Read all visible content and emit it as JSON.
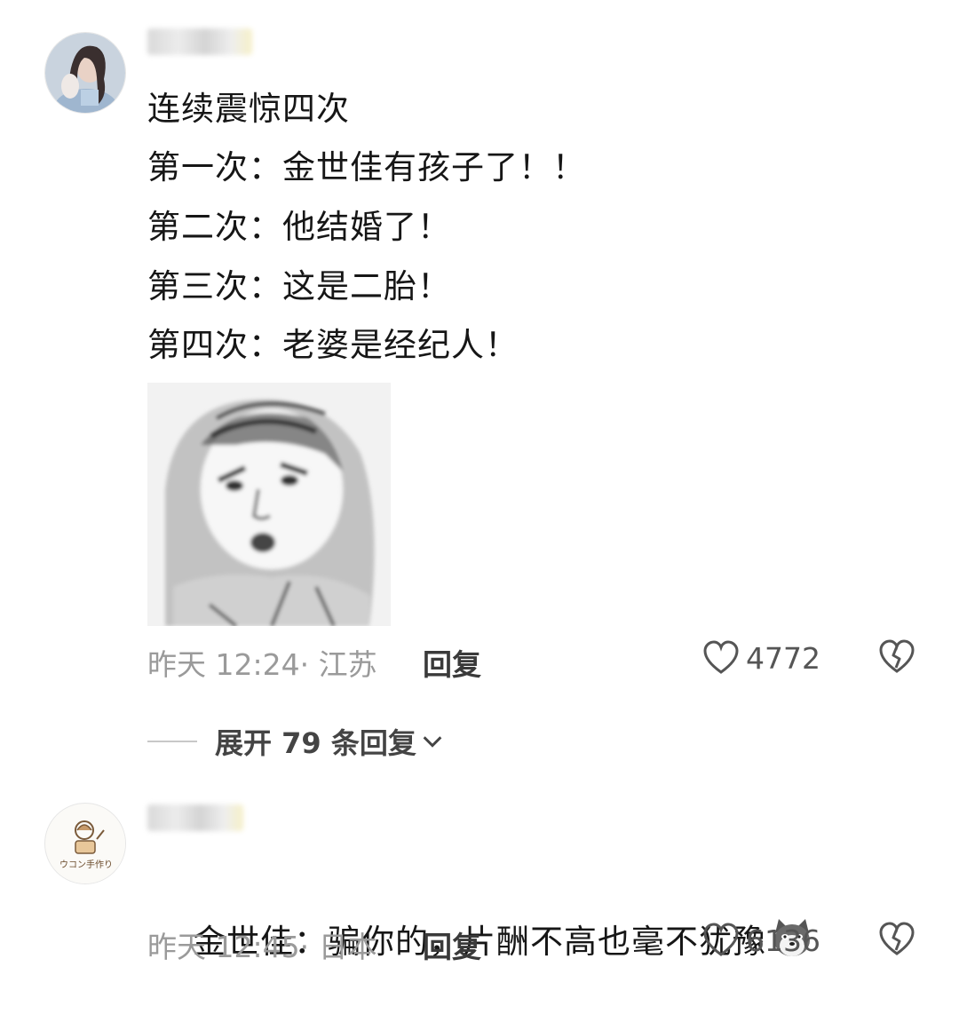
{
  "comments": [
    {
      "lines": [
        "连续震惊四次",
        "第一次：金世佳有孩子了！！",
        "第二次：他结婚了！",
        "第三次：这是二胎！",
        "第四次：老婆是经纪人！"
      ],
      "time": "昨天 12:24· 江苏",
      "reply_label": "回复",
      "likes": "4772",
      "expand_label": "展开 79 条回复",
      "avatar_icon": "user-avatar-photo",
      "sticker_icon": "shocked-face-sticker"
    },
    {
      "text": "金世佳：骗你的，片酬不高也毫不犹豫",
      "time": "昨天 12:45· 日本",
      "reply_label": "回复",
      "likes": "6136",
      "avatar_text": "ウコン手作り",
      "emoji_icon": "husky-dog-emoji"
    }
  ],
  "colors": {
    "meta": "#9a9a9a",
    "text": "#161616",
    "background": "#ffffff"
  }
}
